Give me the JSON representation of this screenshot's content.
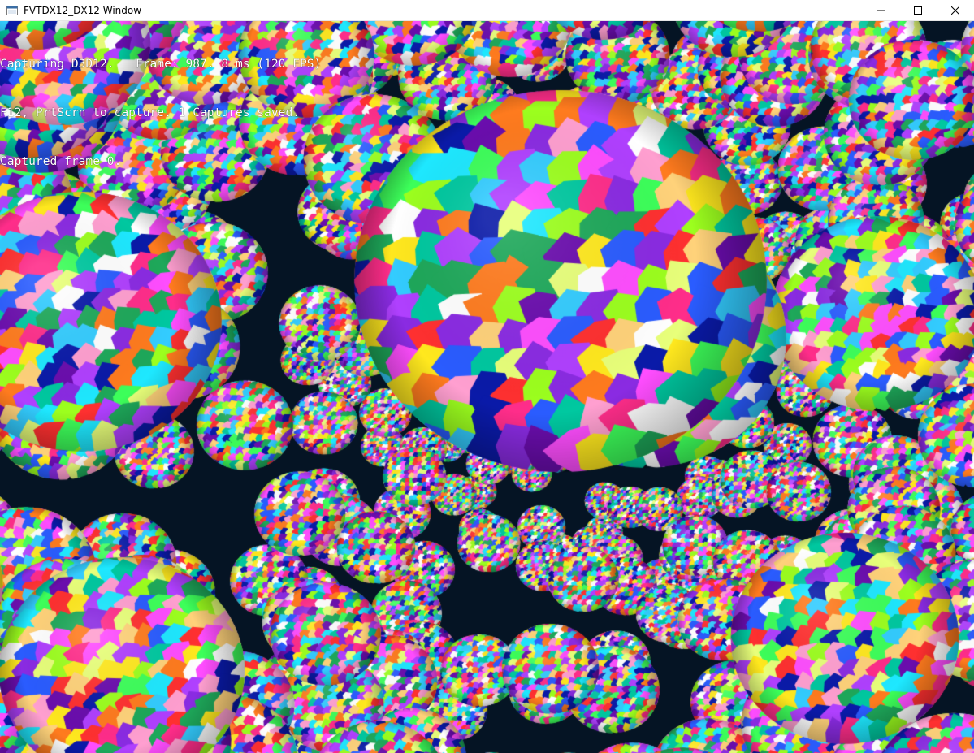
{
  "window": {
    "title": "FVTDX12_DX12-Window",
    "buttons": {
      "minimize_icon": "minimize-icon",
      "maximize_icon": "maximize-icon",
      "close_icon": "close-icon"
    }
  },
  "overlay": {
    "lines": [
      "Capturing D3D12.   Frame: 987. 8 ms (120 FPS)",
      "F12, PrtScrn to capture. 1 Captures saved.",
      "Captured frame 0."
    ]
  },
  "scene": {
    "background": "#051424",
    "palette": [
      "#ff2d8a",
      "#3dff5a",
      "#2a5cff",
      "#ffe81e",
      "#b040ff",
      "#1ee8ff",
      "#ff7b1e",
      "#9cff1e",
      "#ff4dff",
      "#0a1aa8",
      "#ff9fd0",
      "#1ea85a",
      "#8a2be2",
      "#ffd27a",
      "#00c8a0",
      "#e8ff7a",
      "#ff3030",
      "#6a0dad",
      "#33ccff",
      "#ffffff"
    ],
    "icon": "scene-render"
  }
}
